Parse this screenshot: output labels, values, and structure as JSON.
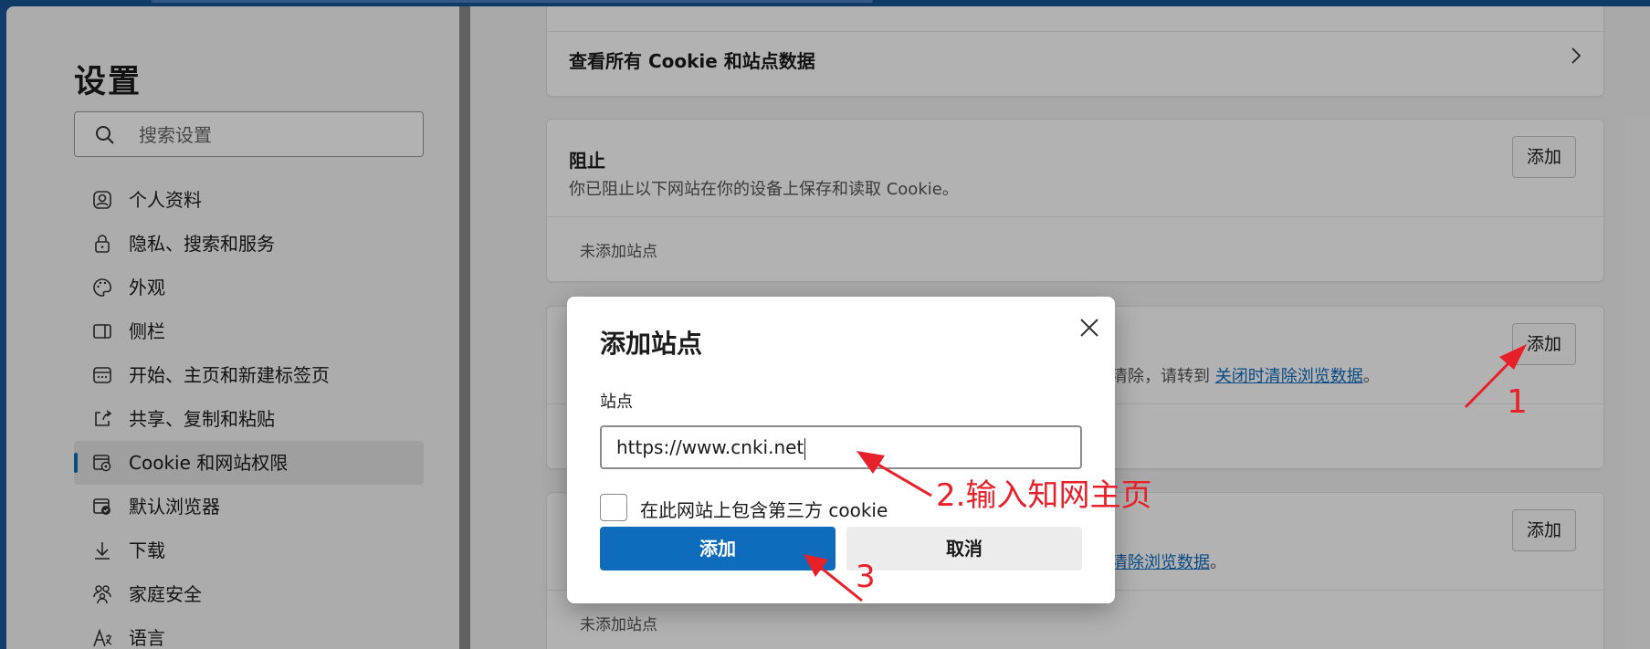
{
  "sidebar": {
    "title": "设置",
    "search_placeholder": "搜索设置",
    "items": [
      {
        "label": "个人资料",
        "icon": "profile-icon"
      },
      {
        "label": "隐私、搜索和服务",
        "icon": "lock-icon"
      },
      {
        "label": "外观",
        "icon": "palette-icon"
      },
      {
        "label": "侧栏",
        "icon": "sidebar-icon"
      },
      {
        "label": "开始、主页和新建标签页",
        "icon": "home-tab-icon"
      },
      {
        "label": "共享、复制和粘贴",
        "icon": "share-icon"
      },
      {
        "label": "Cookie 和网站权限",
        "icon": "cookie-permissions-icon",
        "active": true
      },
      {
        "label": "默认浏览器",
        "icon": "default-browser-icon"
      },
      {
        "label": "下载",
        "icon": "download-icon"
      },
      {
        "label": "家庭安全",
        "icon": "family-icon"
      },
      {
        "label": "语言",
        "icon": "language-icon"
      }
    ]
  },
  "main": {
    "view_all_label": "查看所有 Cookie 和站点数据",
    "block": {
      "title": "阻止",
      "description": "你已阻止以下网站在你的设备上保存和读取 Cookie。",
      "add_label": "添加",
      "empty_label": "未添加站点"
    },
    "allow": {
      "add_label": "添加",
      "desc_tail": "清除，请转到 ",
      "link_label": "关闭时清除浏览数据",
      "desc_end": "。"
    },
    "clear": {
      "add_label": "添加",
      "link_label": "清除浏览数据",
      "desc_end": "。",
      "empty_label": "未添加站点"
    }
  },
  "dialog": {
    "title": "添加站点",
    "site_label": "站点",
    "site_value": "https://www.cnki.net",
    "third_party_label": "在此网站上包含第三方 cookie",
    "third_party_checked": false,
    "add_label": "添加",
    "cancel_label": "取消"
  },
  "annotations": {
    "step1": "1",
    "step2": "2.输入知网主页",
    "step3": "3",
    "color": "#e8202a"
  },
  "colors": {
    "accent": "#0f6cbd",
    "titlebar": "#1a5a9c"
  }
}
